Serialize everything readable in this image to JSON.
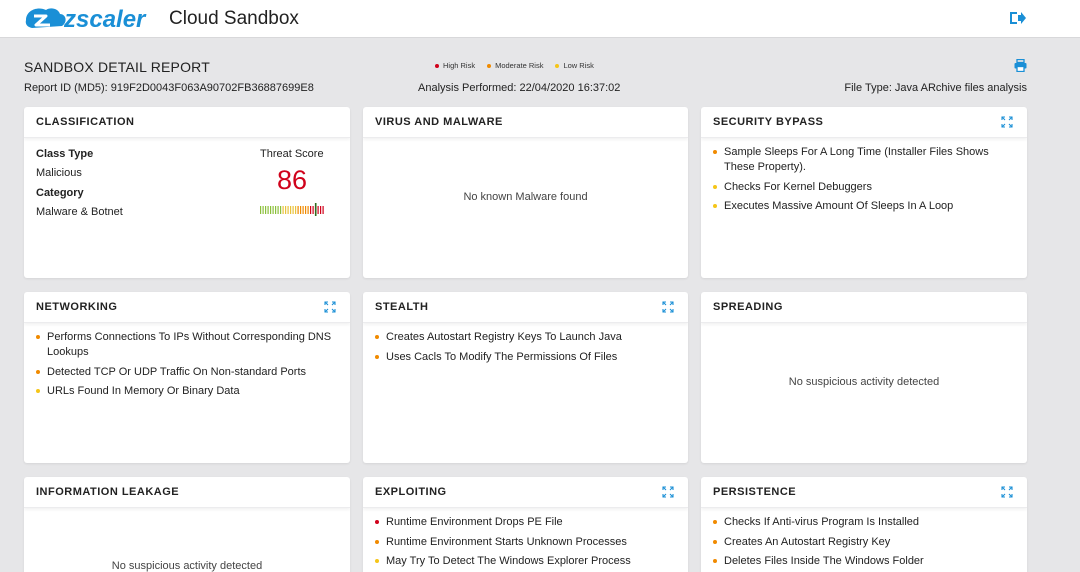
{
  "header": {
    "logo_text": "zscaler",
    "app_title": "Cloud Sandbox",
    "logout_icon": "logout-icon"
  },
  "report": {
    "title": "SANDBOX DETAIL REPORT",
    "report_id": "Report ID (MD5): 919F2D0043F063A90702FB36887699E8",
    "analysis": "Analysis Performed: 22/04/2020 16:37:02",
    "file_type": "File Type: Java ARchive files analysis",
    "print_icon": "printer-icon"
  },
  "legend": [
    {
      "label": "High Risk",
      "color": "#d0021b"
    },
    {
      "label": "Moderate Risk",
      "color": "#f08a00"
    },
    {
      "label": "Low Risk",
      "color": "#f5c518"
    }
  ],
  "colors": {
    "high": "#d0021b",
    "moderate": "#f08a00",
    "low": "#f5c518",
    "accent": "#1a8fd6"
  },
  "classification": {
    "title": "CLASSIFICATION",
    "class_type_label": "Class Type",
    "class_type_value": "Malicious",
    "category_label": "Category",
    "category_value": "Malware & Botnet",
    "threat_label": "Threat Score",
    "threat_score": "86"
  },
  "virus": {
    "title": "VIRUS AND MALWARE",
    "message": "No known Malware found"
  },
  "security_bypass": {
    "title": "SECURITY BYPASS",
    "items": [
      {
        "text": "Sample Sleeps For A Long Time (Installer Files Shows These Property).",
        "risk": "moderate"
      },
      {
        "text": "Checks For Kernel Debuggers",
        "risk": "low"
      },
      {
        "text": "Executes Massive Amount Of Sleeps In A Loop",
        "risk": "low"
      }
    ]
  },
  "networking": {
    "title": "NETWORKING",
    "items": [
      {
        "text": "Performs Connections To IPs Without Corresponding DNS Lookups",
        "risk": "moderate"
      },
      {
        "text": "Detected TCP Or UDP Traffic On Non-standard Ports",
        "risk": "moderate"
      },
      {
        "text": "URLs Found In Memory Or Binary Data",
        "risk": "low"
      }
    ]
  },
  "stealth": {
    "title": "STEALTH",
    "items": [
      {
        "text": "Creates Autostart Registry Keys To Launch Java",
        "risk": "moderate"
      },
      {
        "text": "Uses Cacls To Modify The Permissions Of Files",
        "risk": "moderate"
      }
    ]
  },
  "spreading": {
    "title": "SPREADING",
    "message": "No suspicious activity detected"
  },
  "info_leakage": {
    "title": "INFORMATION LEAKAGE",
    "message": "No suspicious activity detected"
  },
  "exploiting": {
    "title": "EXPLOITING",
    "items": [
      {
        "text": "Runtime Environment Drops PE File",
        "risk": "high"
      },
      {
        "text": "Runtime Environment Starts Unknown Processes",
        "risk": "moderate"
      },
      {
        "text": "May Try To Detect The Windows Explorer Process",
        "risk": "low"
      }
    ]
  },
  "persistence": {
    "title": "PERSISTENCE",
    "items": [
      {
        "text": "Checks If Anti-virus Program Is Installed",
        "risk": "moderate"
      },
      {
        "text": "Creates An Autostart Registry Key",
        "risk": "moderate"
      },
      {
        "text": "Deletes Files Inside The Windows Folder",
        "risk": "moderate"
      }
    ]
  }
}
